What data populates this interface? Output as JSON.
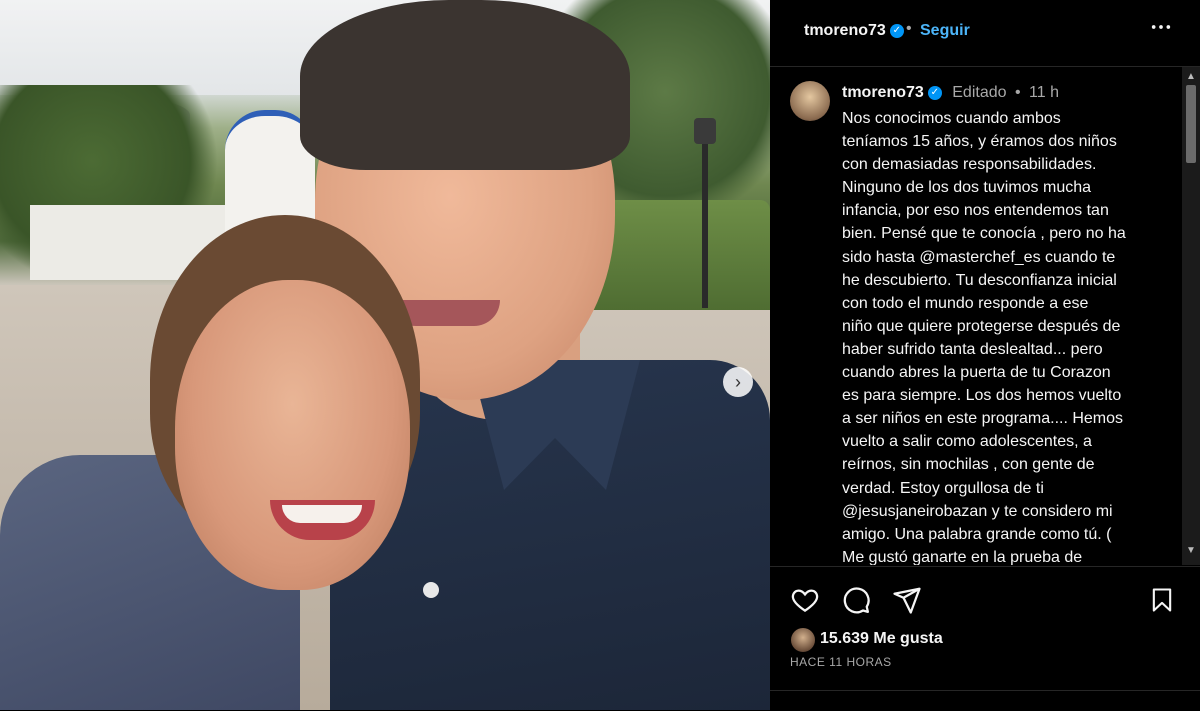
{
  "header": {
    "username": "tmoreno73",
    "separator": "•",
    "follow_label": "Seguir",
    "more_icon": "more-horizontal-icon"
  },
  "caption": {
    "username": "tmoreno73",
    "edited_label": "Editado",
    "separator": "•",
    "time": "11 h",
    "text": "Nos conocimos cuando ambos\ntení­amos 15 años, y éramos dos niños\ncon demasiadas responsabilidades.\nNinguno de los dos tuvimos mucha\ninfancia, por eso nos entendemos tan\nbien. Pensé que te conocía , pero no ha\nsido hasta @masterchef_es cuando te\nhe descubierto. Tu desconfianza inicial\ncon todo el mundo responde a ese\nniño que quiere protegerse después de\nhaber sufrido tanta deslealtad... pero\ncuando abres la puerta de tu Corazon\nes para siempre. Los dos hemos vuelto\na ser niños en este programa.... Hemos\nvuelto a salir como adolescentes, a\nreírnos, sin mochilas , con gente de\nverdad. Estoy orgullosa de ti\n@jesusjaneirobazan y te considero mi\namigo. Una palabra grande como tú. (\nMe gustó ganarte en la prueba de"
  },
  "actions": {
    "like_icon": "heart-icon",
    "comment_icon": "comment-icon",
    "share_icon": "send-icon",
    "save_icon": "bookmark-icon"
  },
  "likes": {
    "text": "15.639 Me gusta"
  },
  "timeago": "HACE 11 HORAS",
  "carousel": {
    "next_glyph": "›"
  },
  "colors": {
    "background": "#000000",
    "accent": "#0095f6",
    "follow": "#4cb5f9",
    "muted": "#a8a8a8"
  }
}
